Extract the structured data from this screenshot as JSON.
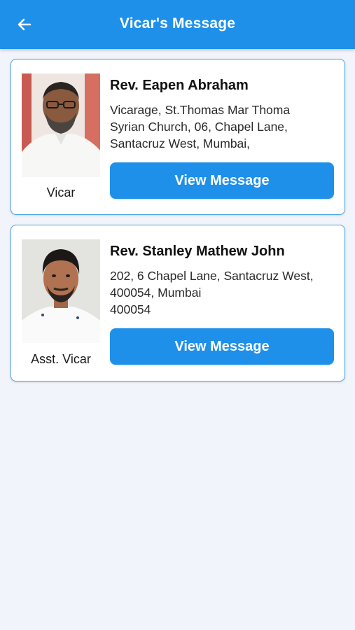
{
  "header": {
    "title": "Vicar's Message",
    "back_icon": "arrow-left-icon",
    "background": "#1e90ea"
  },
  "cards": [
    {
      "name": "Rev. Eapen Abraham",
      "role": "Vicar",
      "address_lines": [
        "Vicarage, St.Thomas Mar Thoma",
        "Syrian Church, 06, Chapel Lane,",
        "Santacruz West, Mumbai,"
      ],
      "button_label": "View Message"
    },
    {
      "name": "Rev. Stanley Mathew John",
      "role": "Asst. Vicar",
      "address_lines": [
        "202, 6 Chapel Lane, Santacruz West,",
        "400054, Mumbai",
        "400054"
      ],
      "button_label": "View Message"
    }
  ]
}
